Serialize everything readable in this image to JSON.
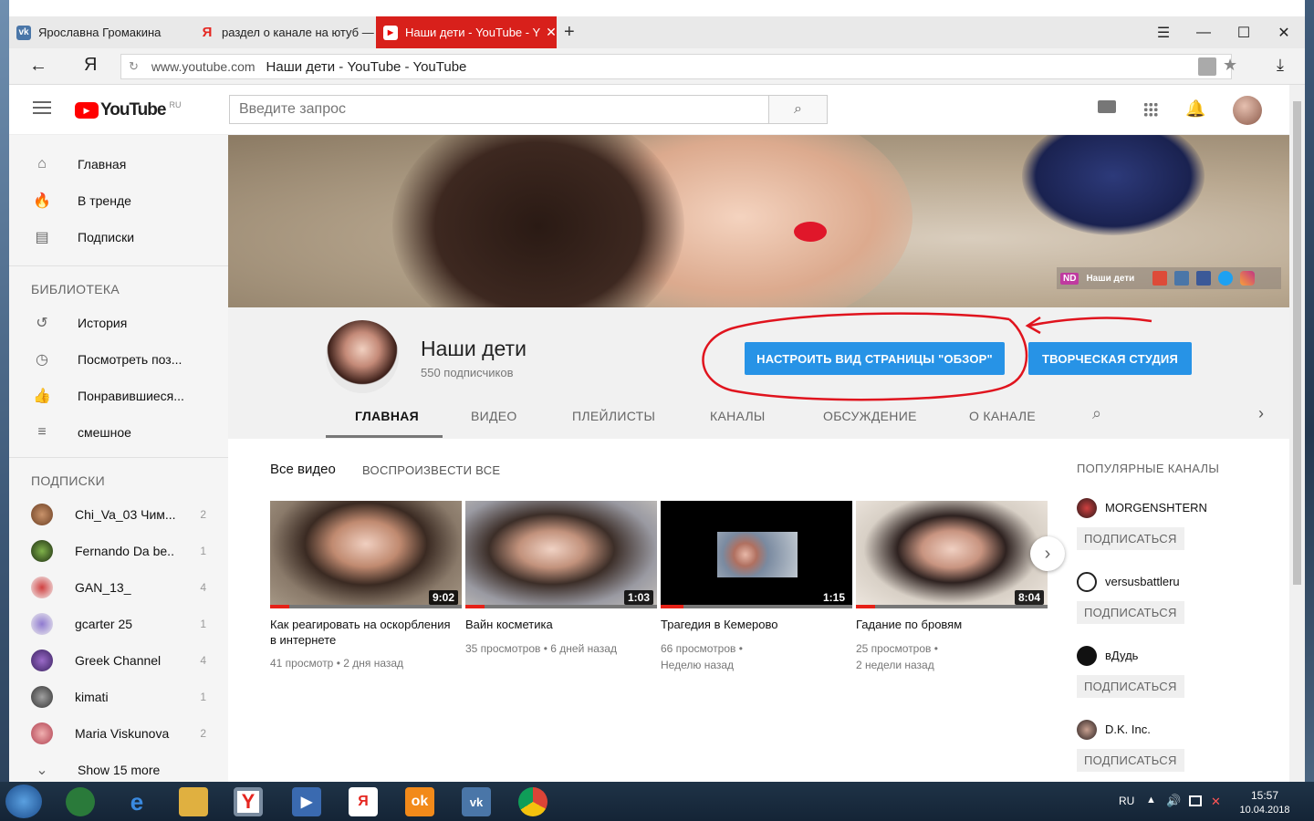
{
  "browser": {
    "tabs": [
      {
        "label": "Ярославна Громакина",
        "icon": "vk-icon"
      },
      {
        "label": "раздел о канале на ютуб —",
        "icon": "yandex-icon"
      },
      {
        "label": "Наши дети - YouTube - Y",
        "icon": "youtube-icon"
      }
    ],
    "url_domain": "www.youtube.com",
    "url_title": "Наши дети - YouTube - YouTube",
    "back_icon": "←",
    "yandex_logo": "Я"
  },
  "masthead": {
    "logo": "YouTube",
    "region": "RU",
    "search_placeholder": "Введите запрос"
  },
  "sidebar": {
    "nav": [
      {
        "label": "Главная",
        "icon": "home-icon"
      },
      {
        "label": "В тренде",
        "icon": "trending-icon"
      },
      {
        "label": "Подписки",
        "icon": "subscriptions-icon"
      }
    ],
    "library_header": "БИБЛИОТЕКА",
    "library": [
      {
        "label": "История",
        "icon": "history-icon"
      },
      {
        "label": "Посмотреть поз...",
        "icon": "clock-icon"
      },
      {
        "label": "Понравившиеся...",
        "icon": "like-icon"
      },
      {
        "label": "смешное",
        "icon": "playlist-icon"
      }
    ],
    "subs_header": "ПОДПИСКИ",
    "subs": [
      {
        "label": "Chi_Va_03 Чим...",
        "count": "2"
      },
      {
        "label": "Fernando Da be...",
        "count": "1"
      },
      {
        "label": "GAN_13_",
        "count": "4"
      },
      {
        "label": "gcarter 25",
        "count": "1"
      },
      {
        "label": "Greek Channel",
        "count": "4"
      },
      {
        "label": "kimati",
        "count": "1"
      },
      {
        "label": "Maria Viskunova",
        "count": "2"
      }
    ],
    "show_more": "Show 15 more"
  },
  "channel": {
    "name": "Наши дети",
    "subscribers": "550 подписчиков",
    "banner_label": "Наши дети",
    "customize_button": "НАСТРОИТЬ ВИД СТРАНИЦЫ \"ОБЗОР\"",
    "studio_button": "ТВОРЧЕСКАЯ СТУДИЯ",
    "tabs": [
      "ГЛАВНАЯ",
      "ВИДЕО",
      "ПЛЕЙЛИСТЫ",
      "КАНАЛЫ",
      "ОБСУЖДЕНИЕ",
      "О КАНАЛЕ"
    ],
    "active_tab": "ГЛАВНАЯ"
  },
  "videos_section": {
    "title": "Все видео",
    "play_all": "ВОСПРОИЗВЕСТИ ВСЕ",
    "videos": [
      {
        "title": "Как реагировать на оскорбления в интернете",
        "duration": "9:02",
        "meta1": "41 просмотр • 2 дня назад",
        "meta2": "",
        "progress": 0.1
      },
      {
        "title": "Вайн косметика",
        "duration": "1:03",
        "meta1": "35 просмотров • 6 дней назад",
        "meta2": "",
        "progress": 0.1
      },
      {
        "title": "Трагедия в Кемерово",
        "duration": "1:15",
        "meta1": "66 просмотров •",
        "meta2": "Неделю назад",
        "progress": 0.12
      },
      {
        "title": "Гадание по бровям",
        "duration": "8:04",
        "meta1": "25 просмотров •",
        "meta2": "2 недели назад",
        "progress": 0.1
      }
    ]
  },
  "popular": {
    "header": "ПОПУЛЯРНЫЕ КАНАЛЫ",
    "subscribe_label": "ПОДПИСАТЬСЯ",
    "channels": [
      "MORGENSHTERN",
      "versusbattleru",
      "вДудь",
      "D.K. Inc."
    ]
  },
  "taskbar": {
    "lang": "RU",
    "time": "15:57",
    "date": "10.04.2018"
  },
  "colors": {
    "accent_blue": "#2793e6",
    "youtube_red": "#ff0000",
    "annotation_red": "#e0141e"
  }
}
